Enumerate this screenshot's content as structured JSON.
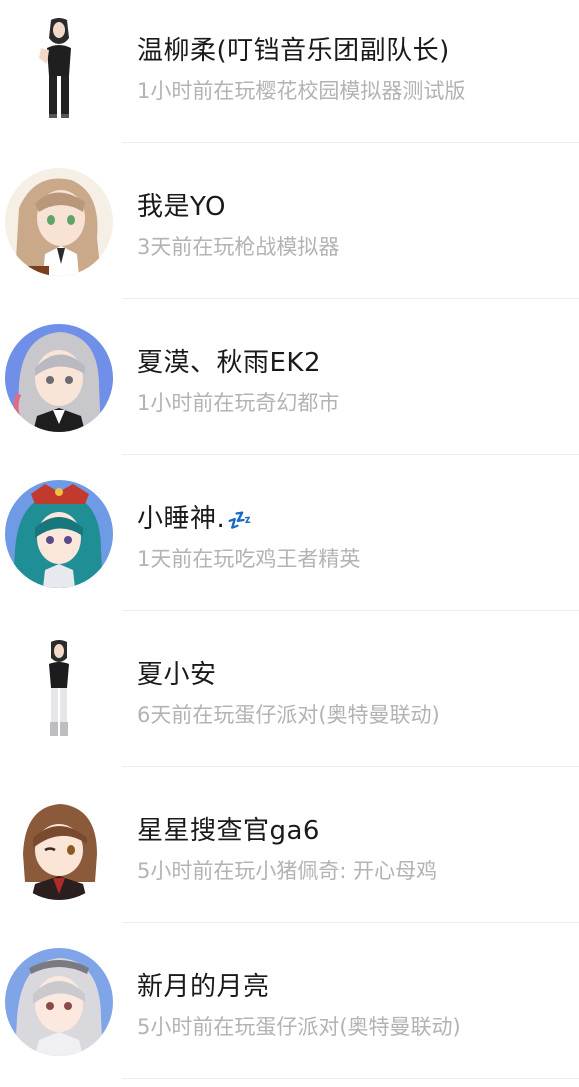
{
  "friends": [
    {
      "name": "温柳柔(叮铛音乐团副队长)",
      "status": "1小时前在玩樱花校园模拟器测试版",
      "avatar_icon": "character-figure-avatar"
    },
    {
      "name": "我是YO",
      "status": "3天前在玩枪战模拟器",
      "avatar_icon": "anime-girl-avatar"
    },
    {
      "name": "夏漠、秋雨EK2",
      "status": "1小时前在玩奇幻都市",
      "avatar_icon": "anime-girl-avatar"
    },
    {
      "name": "小睡神.",
      "name_emoji": "💤",
      "status": "1天前在玩吃鸡王者精英",
      "avatar_icon": "anime-girl-avatar"
    },
    {
      "name": "夏小安",
      "status": "6天前在玩蛋仔派对(奥特曼联动)",
      "avatar_icon": "character-figure-avatar"
    },
    {
      "name": "星星搜查官ga6",
      "status": "5小时前在玩小猪佩奇: 开心母鸡",
      "avatar_icon": "anime-girl-avatar"
    },
    {
      "name": "新月的月亮",
      "status": "5小时前在玩蛋仔派对(奥特曼联动)",
      "avatar_icon": "anime-girl-avatar"
    }
  ]
}
